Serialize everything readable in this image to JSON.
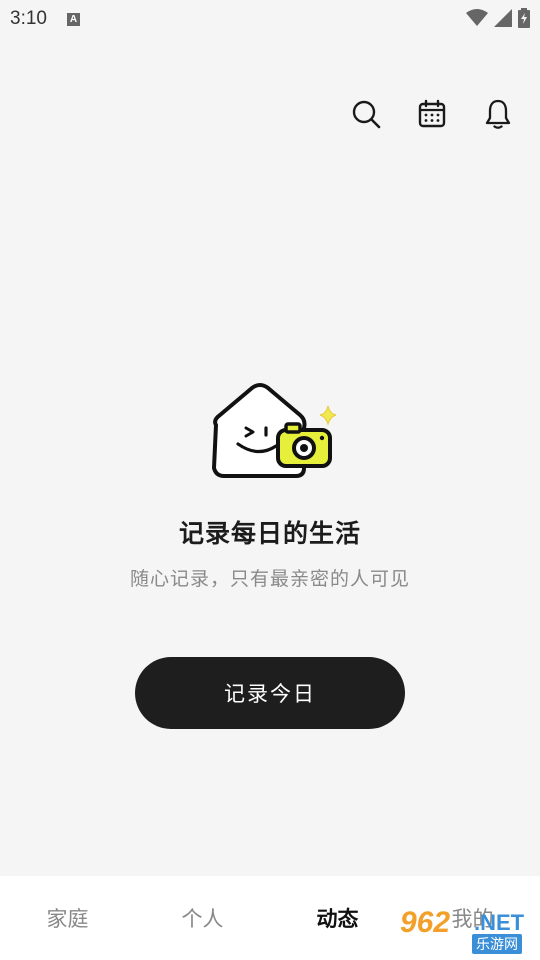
{
  "status_bar": {
    "time": "3:10",
    "notif_letter": "A"
  },
  "toolbar": {
    "icons": [
      "search-icon",
      "calendar-icon",
      "bell-icon"
    ]
  },
  "empty_state": {
    "title": "记录每日的生活",
    "subtitle": "随心记录，只有最亲密的人可见",
    "button_label": "记录今日"
  },
  "tabs": [
    {
      "label": "家庭",
      "active": false
    },
    {
      "label": "个人",
      "active": false
    },
    {
      "label": "动态",
      "active": true
    },
    {
      "label": "我的",
      "active": false
    }
  ],
  "watermark": {
    "number": "962",
    "domain": ".NET",
    "name": "乐游网"
  },
  "colors": {
    "background": "#f5f5f5",
    "button": "#1e1e1e",
    "accent_yellow": "#e6f03a",
    "watermark_orange": "#f3a02a",
    "watermark_blue": "#3a8fd8"
  }
}
